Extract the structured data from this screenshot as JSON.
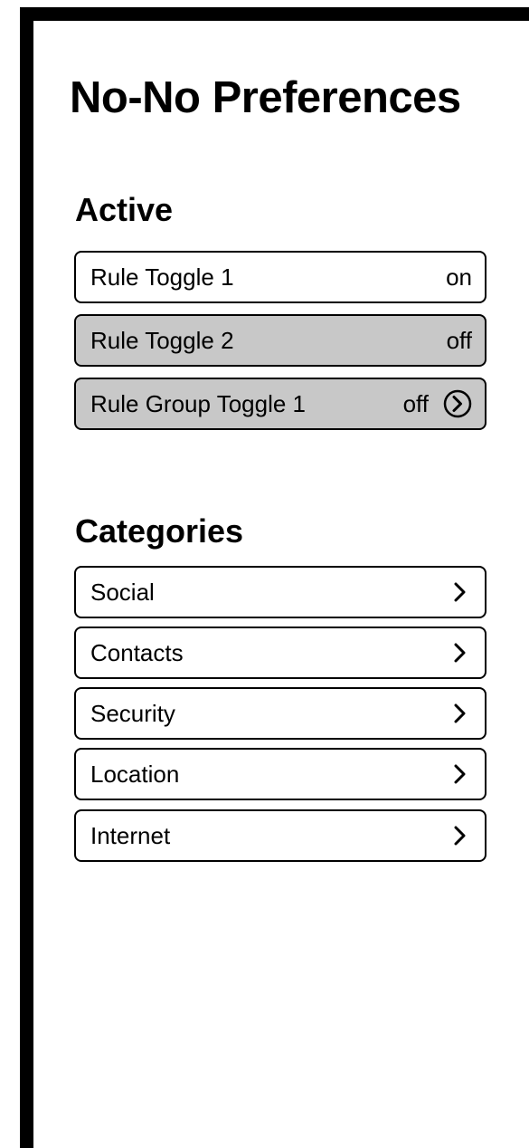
{
  "page": {
    "title": "No-No Preferences"
  },
  "active": {
    "heading": "Active",
    "items": [
      {
        "label": "Rule Toggle 1",
        "state": "on"
      },
      {
        "label": "Rule Toggle 2",
        "state": "off"
      },
      {
        "label": "Rule Group Toggle 1",
        "state": "off",
        "icon": "chevron-circle-right-icon"
      }
    ]
  },
  "categories": {
    "heading": "Categories",
    "items": [
      {
        "label": "Social",
        "icon": "chevron-right-icon"
      },
      {
        "label": "Contacts",
        "icon": "chevron-right-icon"
      },
      {
        "label": "Security",
        "icon": "chevron-right-icon"
      },
      {
        "label": "Location",
        "icon": "chevron-right-icon"
      },
      {
        "label": "Internet",
        "icon": "chevron-right-icon"
      }
    ]
  },
  "colors": {
    "frame": "#000000",
    "off_background": "#c8c8c8",
    "on_background": "#ffffff"
  }
}
